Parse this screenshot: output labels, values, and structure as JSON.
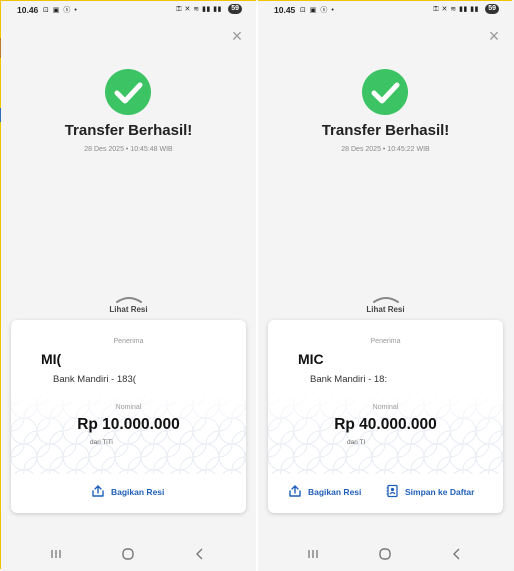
{
  "colors": {
    "success_green": "#3cc363",
    "action_blue": "#1f5fb8",
    "frame_yellow": "#f0c400"
  },
  "screens": [
    {
      "status": {
        "time": "10.46",
        "battery": "59"
      },
      "close_icon": "close-icon",
      "title": "Transfer Berhasil!",
      "timestamp": "28 Des 2025 • 10:45:48 WIB",
      "lihat_resi": "Lihat Resi",
      "receipt": {
        "recipient_label": "Penerima",
        "recipient_name": "MI(",
        "bank_line": "Bank Mandiri - 183(",
        "nominal_label": "Nominal",
        "amount": "Rp 10.000.000",
        "from": "dari TiTi",
        "actions": [
          {
            "label": "Bagikan Resi",
            "icon": "share-icon"
          }
        ]
      }
    },
    {
      "status": {
        "time": "10.45",
        "battery": "59"
      },
      "close_icon": "close-icon",
      "title": "Transfer Berhasil!",
      "timestamp": "28 Des 2025 • 10:45:22 WIB",
      "lihat_resi": "Lihat Resi",
      "receipt": {
        "recipient_label": "Penerima",
        "recipient_name": "MIC",
        "bank_line": "Bank Mandiri - 18:",
        "nominal_label": "Nominal",
        "amount": "Rp 40.000.000",
        "from": "dari TI",
        "actions": [
          {
            "label": "Bagikan Resi",
            "icon": "share-icon"
          },
          {
            "label": "Simpan ke Daftar",
            "icon": "save-contact-icon"
          }
        ]
      }
    }
  ]
}
